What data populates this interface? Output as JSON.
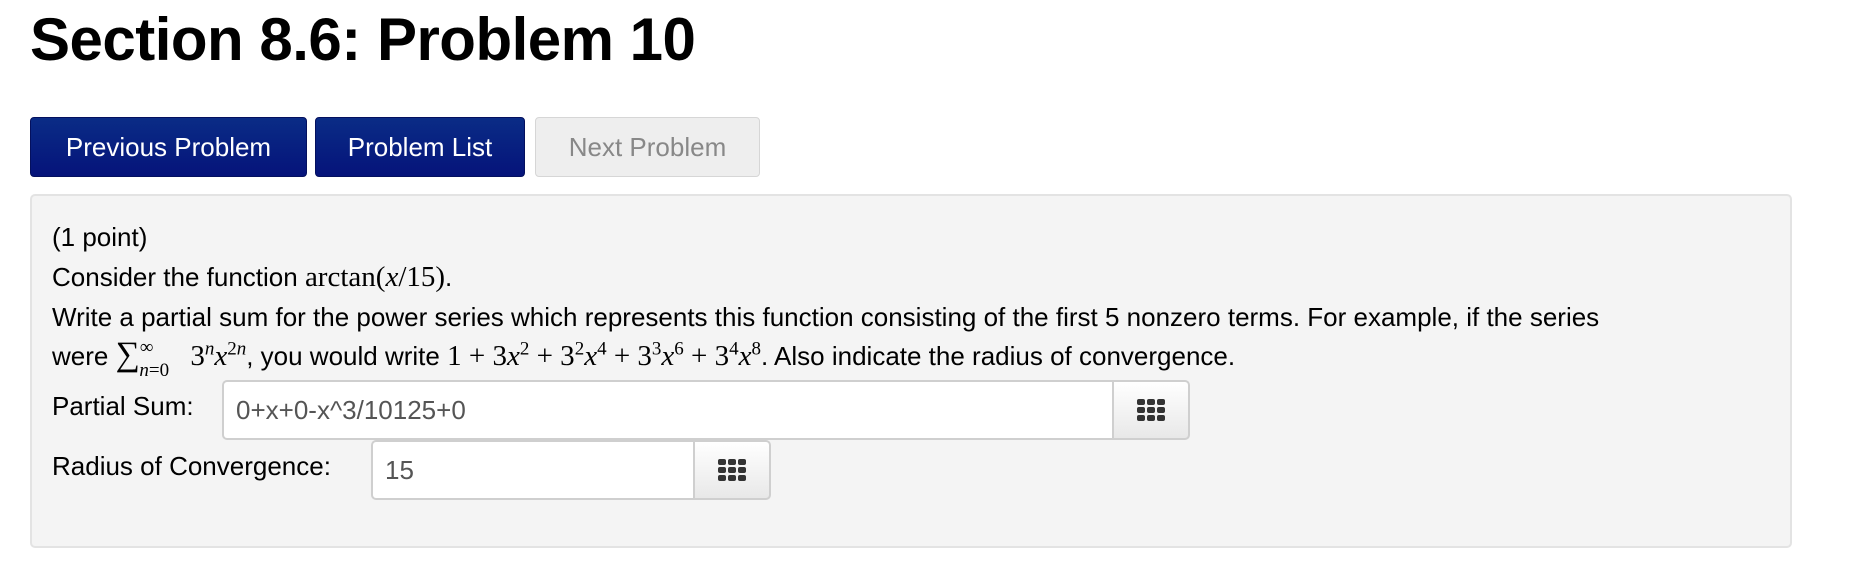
{
  "page": {
    "title": "Section 8.6: Problem 10"
  },
  "nav": {
    "previous_label": "Previous Problem",
    "list_label": "Problem List",
    "next_label": "Next Problem"
  },
  "problem": {
    "points": "(1 point)",
    "intro_text": "Consider the function ",
    "function_math": "arctan(x/15)",
    "instruction": "Write a partial sum for the power series which represents this function consisting of the first 5 nonzero terms. For example, if the series",
    "example_prefix": "were ",
    "example_mid": ", you would write ",
    "example_suffix": ". Also indicate the radius of convergence."
  },
  "fields": {
    "partial_sum": {
      "label": "Partial Sum:",
      "value": "0+x+0-x^3/10125+0",
      "icon": "equation-editor-grid-icon"
    },
    "radius": {
      "label": "Radius of Convergence:",
      "value": "15",
      "icon": "equation-editor-grid-icon"
    }
  }
}
